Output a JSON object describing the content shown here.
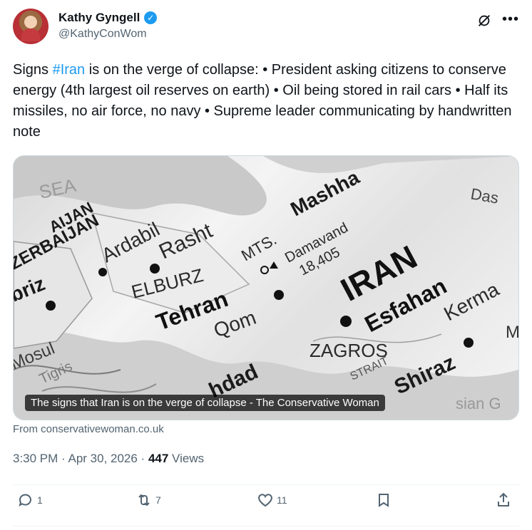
{
  "author": {
    "name": "Kathy Gyngell",
    "handle": "@KathyConWom",
    "verified": true
  },
  "tweet": {
    "text_before": "Signs ",
    "hashtag": "#Iran",
    "text_after": " is on the verge of collapse: • President asking citizens to conserve energy (4th largest oil reserves on earth) • Oil being stored in rail cars • Half its missiles, no air force, no navy • Supreme leader communicating by handwritten note"
  },
  "media": {
    "caption": "The signs that Iran is on the verge of collapse - The Conservative Woman",
    "map_labels": {
      "sea": "SEA",
      "azerbaijan_top": "AIJAN",
      "azerbaijan": "ZERBAIJAN",
      "ardabil": "Ardabil",
      "rasht": "Rasht",
      "mashhad": "Mashha",
      "mts": "MTS.",
      "damavand": "Damavand",
      "damavand_elev": "18,405",
      "elburz": "ELBURZ",
      "tabriz": "briz",
      "tehran": "Tehran",
      "qom": "Qom",
      "iran": "IRAN",
      "esfahan": "Esfahan",
      "kerman": "Kerma",
      "das": "Das",
      "zagros": "ZAGROS",
      "mosul": "Mosul",
      "baghdad": "hdad",
      "shiraz": "Shiraz",
      "tigris": "Tigris",
      "strait": "STRAIT",
      "sian": "sian G",
      "m": "M"
    }
  },
  "source": "From conservativewoman.co.uk",
  "meta": {
    "timestamp": "3:30 PM · Apr 30, 2026 · ",
    "views_count": "447",
    "views_label": " Views"
  },
  "actions": {
    "replies": "1",
    "reposts": "7",
    "likes": "11"
  },
  "colors": {
    "accent": "#1d9bf0",
    "secondary_text": "#536471"
  }
}
